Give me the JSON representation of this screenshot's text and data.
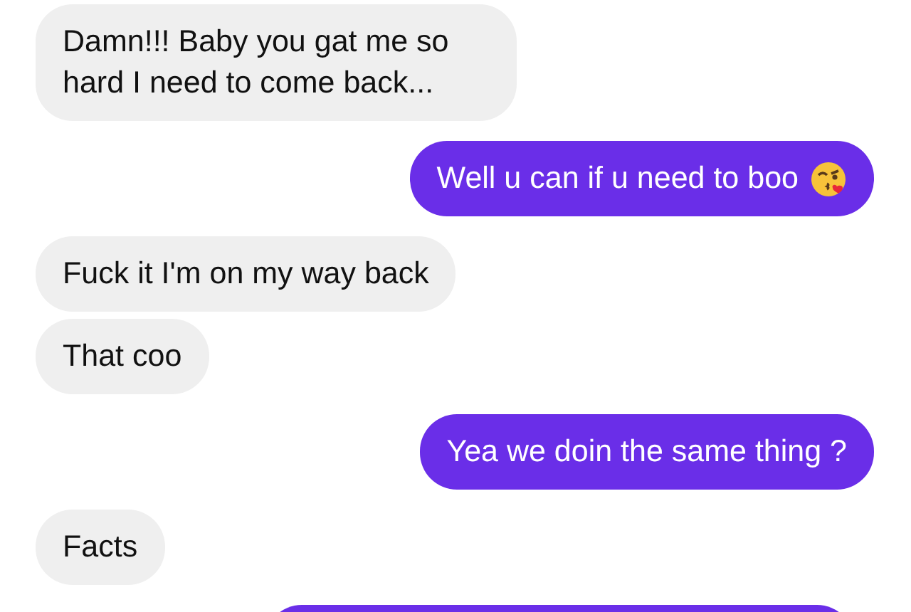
{
  "messages": [
    {
      "kind": "received",
      "text": "Damn!!! Baby you gat me so hard I need to come back..."
    },
    {
      "kind": "sent",
      "text": "Well u can if u need to boo",
      "emoji": true
    },
    {
      "kind": "received",
      "text": "Fuck it I'm on my way back"
    },
    {
      "kind": "received",
      "text": "That coo"
    },
    {
      "kind": "sent",
      "text": "Yea we doin the same thing ?"
    },
    {
      "kind": "received",
      "text": "Facts"
    },
    {
      "kind": "sent"
    }
  ]
}
